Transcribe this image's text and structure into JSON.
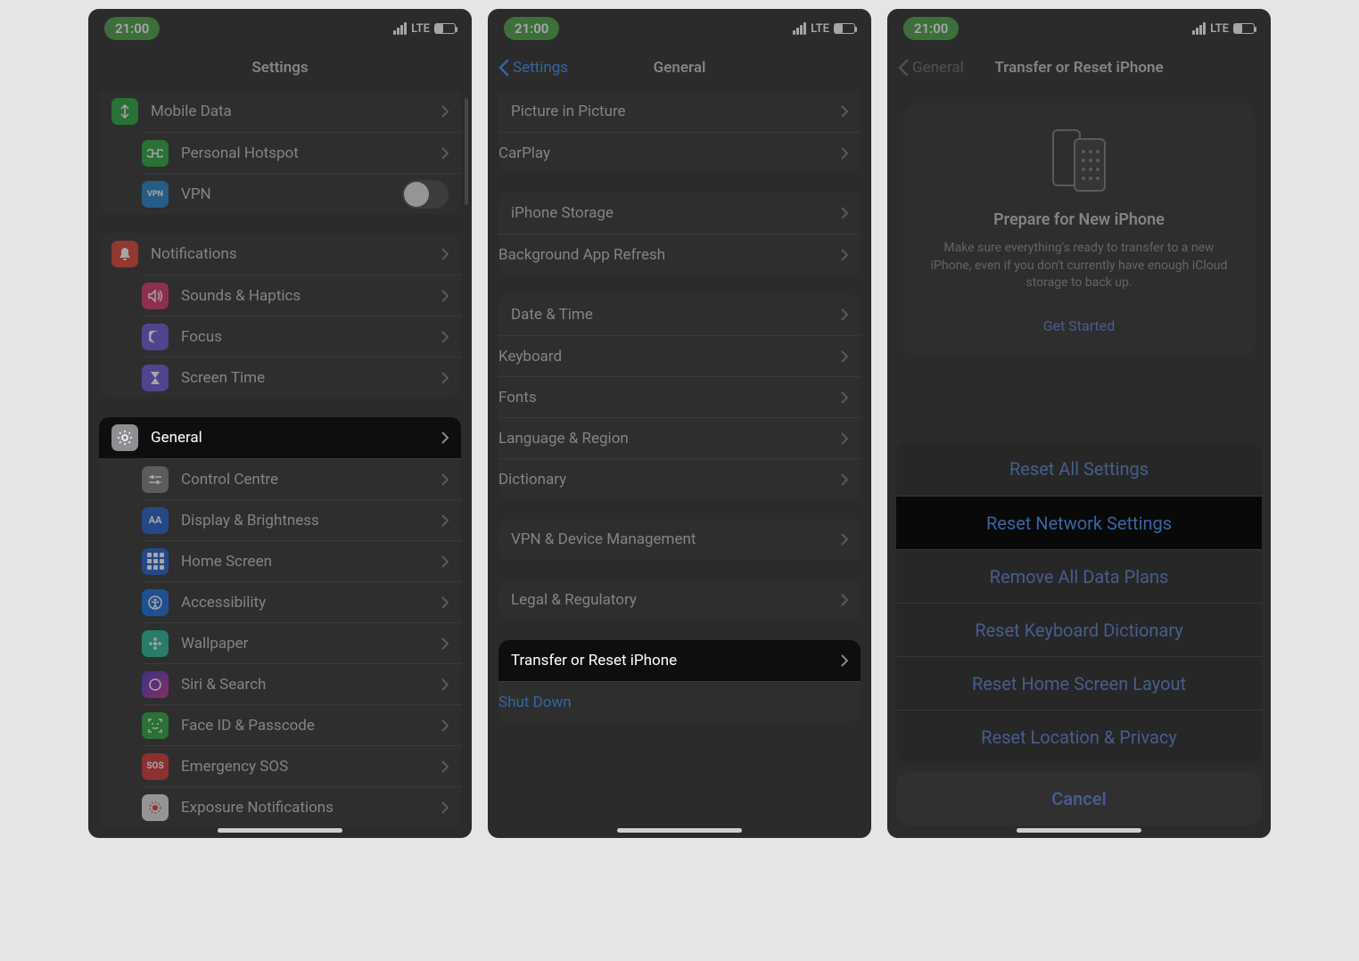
{
  "status": {
    "time": "21:00",
    "net": "LTE"
  },
  "p1": {
    "title": "Settings",
    "g1": {
      "mobile": "Mobile Data",
      "hotspot": "Personal Hotspot",
      "vpn": "VPN"
    },
    "g2": {
      "notif": "Notifications",
      "sounds": "Sounds & Haptics",
      "focus": "Focus",
      "screentime": "Screen Time"
    },
    "g3": {
      "general": "General",
      "control": "Control Centre",
      "display": "Display & Brightness",
      "home": "Home Screen",
      "access": "Accessibility",
      "wall": "Wallpaper",
      "siri": "Siri & Search",
      "faceid": "Face ID & Passcode",
      "sos": "Emergency SOS",
      "exposure": "Exposure Notifications"
    }
  },
  "p2": {
    "back": "Settings",
    "title": "General",
    "g1": {
      "pip": "Picture in Picture",
      "carplay": "CarPlay"
    },
    "g2": {
      "storage": "iPhone Storage",
      "bgapp": "Background App Refresh"
    },
    "g3": {
      "date": "Date & Time",
      "keyboard": "Keyboard",
      "fonts": "Fonts",
      "lang": "Language & Region",
      "dict": "Dictionary"
    },
    "g4": {
      "vpnmgmt": "VPN & Device Management"
    },
    "g5": {
      "legal": "Legal & Regulatory"
    },
    "g6": {
      "transfer": "Transfer or Reset iPhone",
      "shutdown": "Shut Down"
    }
  },
  "p3": {
    "back": "General",
    "title": "Transfer or Reset iPhone",
    "card": {
      "title": "Prepare for New iPhone",
      "desc": "Make sure everything's ready to transfer to a new iPhone, even if you don't currently have enough iCloud storage to back up.",
      "cta": "Get Started"
    },
    "sheet": {
      "items": [
        "Reset All Settings",
        "Reset Network Settings",
        "Remove All Data Plans",
        "Reset Keyboard Dictionary",
        "Reset Home Screen Layout",
        "Reset Location & Privacy"
      ],
      "cancel": "Cancel"
    }
  }
}
